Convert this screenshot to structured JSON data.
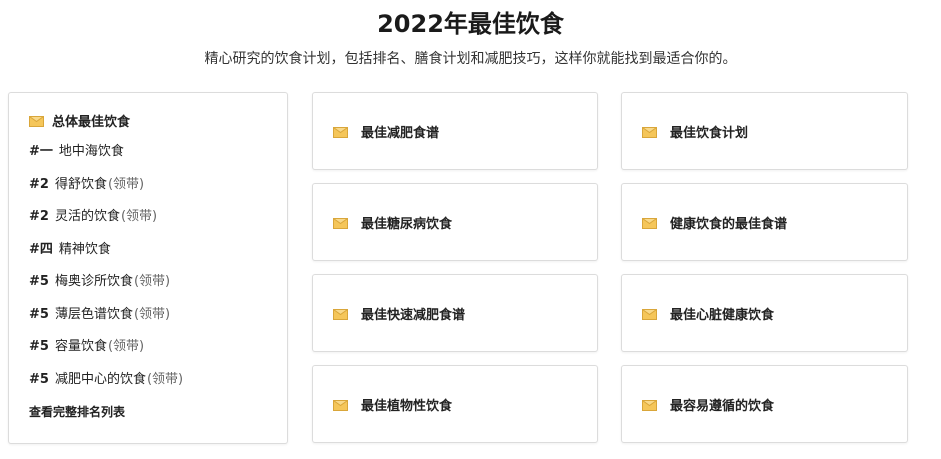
{
  "header": {
    "title": "2022年最佳饮食",
    "subtitle": "精心研究的饮食计划，包括排名、膳食计划和减肥技巧，这样你就能找到最适合你的。"
  },
  "ranking": {
    "heading": "总体最佳饮食",
    "items": [
      {
        "rank": "#一",
        "name": "地中海饮食",
        "tag": ""
      },
      {
        "rank": "#2",
        "name": "得舒饮食",
        "tag": "(领带)"
      },
      {
        "rank": "#2",
        "name": "灵活的饮食",
        "tag": "(领带)"
      },
      {
        "rank": "#四",
        "name": "精神饮食",
        "tag": ""
      },
      {
        "rank": "#5",
        "name": "梅奥诊所饮食",
        "tag": "(领带)"
      },
      {
        "rank": "#5",
        "name": "薄层色谱饮食",
        "tag": "(领带)"
      },
      {
        "rank": "#5",
        "name": "容量饮食",
        "tag": "(领带)"
      },
      {
        "rank": "#5",
        "name": "减肥中心的饮食",
        "tag": "(领带)"
      }
    ],
    "view_full": "查看完整排名列表"
  },
  "tiles": [
    {
      "label": "最佳减肥食谱"
    },
    {
      "label": "最佳饮食计划"
    },
    {
      "label": "最佳糖尿病饮食"
    },
    {
      "label": "健康饮食的最佳食谱"
    },
    {
      "label": "最佳快速减肥食谱"
    },
    {
      "label": "最佳心脏健康饮食"
    },
    {
      "label": "最佳植物性饮食"
    },
    {
      "label": "最容易遵循的饮食"
    }
  ],
  "icons": {
    "envelope": "envelope-icon"
  },
  "colors": {
    "icon_fill": "#f5c65a",
    "icon_dark": "#d9a63a",
    "border": "#dcdcdc",
    "tag": "#666666"
  }
}
